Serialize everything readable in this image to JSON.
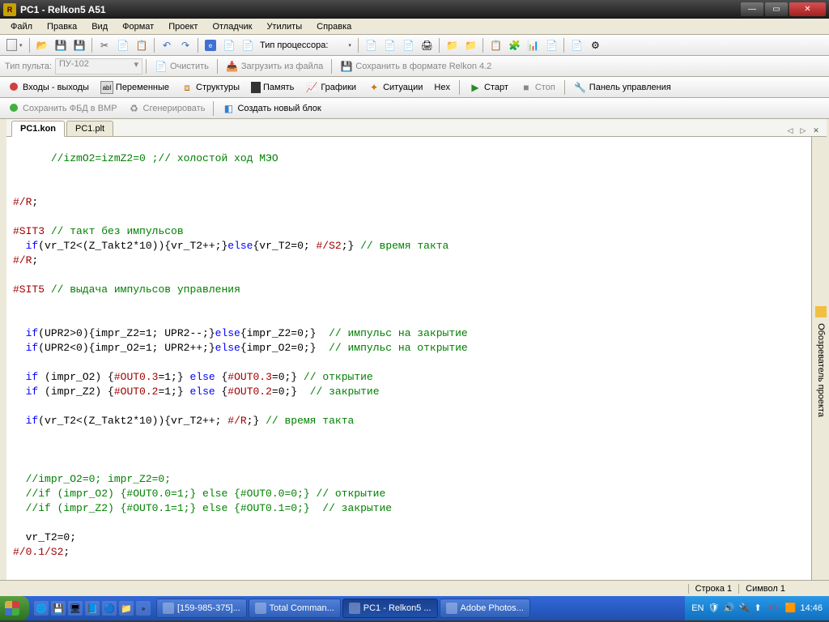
{
  "window": {
    "title": "PC1 - Relkon5 A51"
  },
  "menu": [
    "Файл",
    "Правка",
    "Вид",
    "Формат",
    "Проект",
    "Отладчик",
    "Утилиты",
    "Справка"
  ],
  "toolbar2": {
    "console_type_label": "Тип пульта:",
    "console_value": "ПУ-102",
    "clear": "Очистить",
    "load_file": "Загрузить из файла",
    "save_fmt": "Сохранить в формате Relkon 4.2",
    "cpu_type": "Тип процессора:"
  },
  "toolbar3": {
    "io": "Входы - выходы",
    "vars": "Переменные",
    "structs": "Структуры",
    "mem": "Память",
    "charts": "Графики",
    "sit": "Ситуации",
    "hex": "Hex",
    "start": "Старт",
    "stop": "Стоп",
    "panel": "Панель управления"
  },
  "toolbar4": {
    "save_fbd": "Сохранить ФБД в BMP",
    "regen": "Сгенерировать",
    "newblock": "Создать новый блок"
  },
  "tabs": {
    "t1": "PC1.kon",
    "t2": "PC1.plt"
  },
  "code": [
    {
      "pre": "      ",
      "seg": [
        {
          "c": "com",
          "t": "//izmO2=izmZ2=0 ;// холостой ход МЭО"
        }
      ]
    },
    {
      "pre": "",
      "seg": []
    },
    {
      "pre": "",
      "seg": []
    },
    {
      "pre": "",
      "seg": [
        {
          "c": "dir",
          "t": "#/R"
        },
        {
          "c": "txt",
          "t": ";"
        }
      ]
    },
    {
      "pre": "",
      "seg": []
    },
    {
      "pre": "",
      "seg": [
        {
          "c": "dir",
          "t": "#SIT3"
        },
        {
          "c": "txt",
          "t": " "
        },
        {
          "c": "com",
          "t": "// такт без импульсов"
        }
      ]
    },
    {
      "pre": "  ",
      "seg": [
        {
          "c": "key",
          "t": "if"
        },
        {
          "c": "txt",
          "t": "(vr_T2<(Z_Takt2*10)){vr_T2++;}"
        },
        {
          "c": "key",
          "t": "else"
        },
        {
          "c": "txt",
          "t": "{vr_T2=0; "
        },
        {
          "c": "dir",
          "t": "#/S2"
        },
        {
          "c": "txt",
          "t": ";} "
        },
        {
          "c": "com",
          "t": "// время такта"
        }
      ]
    },
    {
      "pre": "",
      "seg": [
        {
          "c": "dir",
          "t": "#/R"
        },
        {
          "c": "txt",
          "t": ";"
        }
      ]
    },
    {
      "pre": "",
      "seg": []
    },
    {
      "pre": "",
      "seg": [
        {
          "c": "dir",
          "t": "#SIT5"
        },
        {
          "c": "txt",
          "t": " "
        },
        {
          "c": "com",
          "t": "// выдача импульсов управления"
        }
      ]
    },
    {
      "pre": "",
      "seg": []
    },
    {
      "pre": "",
      "seg": []
    },
    {
      "pre": "  ",
      "seg": [
        {
          "c": "key",
          "t": "if"
        },
        {
          "c": "txt",
          "t": "(UPR2>0){impr_Z2=1; UPR2--;}"
        },
        {
          "c": "key",
          "t": "else"
        },
        {
          "c": "txt",
          "t": "{impr_Z2=0;}  "
        },
        {
          "c": "com",
          "t": "// импульс на закрытие"
        }
      ]
    },
    {
      "pre": "  ",
      "seg": [
        {
          "c": "key",
          "t": "if"
        },
        {
          "c": "txt",
          "t": "(UPR2<0){impr_O2=1; UPR2++;}"
        },
        {
          "c": "key",
          "t": "else"
        },
        {
          "c": "txt",
          "t": "{impr_O2=0;}  "
        },
        {
          "c": "com",
          "t": "// импульс на открытие"
        }
      ]
    },
    {
      "pre": "",
      "seg": []
    },
    {
      "pre": "  ",
      "seg": [
        {
          "c": "key",
          "t": "if"
        },
        {
          "c": "txt",
          "t": " (impr_O2) {"
        },
        {
          "c": "dir",
          "t": "#OUT0.3"
        },
        {
          "c": "txt",
          "t": "=1;} "
        },
        {
          "c": "key",
          "t": "else"
        },
        {
          "c": "txt",
          "t": " {"
        },
        {
          "c": "dir",
          "t": "#OUT0.3"
        },
        {
          "c": "txt",
          "t": "=0;} "
        },
        {
          "c": "com",
          "t": "// открытие"
        }
      ]
    },
    {
      "pre": "  ",
      "seg": [
        {
          "c": "key",
          "t": "if"
        },
        {
          "c": "txt",
          "t": " (impr_Z2) {"
        },
        {
          "c": "dir",
          "t": "#OUT0.2"
        },
        {
          "c": "txt",
          "t": "=1;} "
        },
        {
          "c": "key",
          "t": "else"
        },
        {
          "c": "txt",
          "t": " {"
        },
        {
          "c": "dir",
          "t": "#OUT0.2"
        },
        {
          "c": "txt",
          "t": "=0;}  "
        },
        {
          "c": "com",
          "t": "// закрытие"
        }
      ]
    },
    {
      "pre": "",
      "seg": []
    },
    {
      "pre": "  ",
      "seg": [
        {
          "c": "key",
          "t": "if"
        },
        {
          "c": "txt",
          "t": "(vr_T2<(Z_Takt2*10)){vr_T2++; "
        },
        {
          "c": "dir",
          "t": "#/R"
        },
        {
          "c": "txt",
          "t": ";} "
        },
        {
          "c": "com",
          "t": "// время такта"
        }
      ]
    },
    {
      "pre": "",
      "seg": []
    },
    {
      "pre": "",
      "seg": []
    },
    {
      "pre": "",
      "seg": []
    },
    {
      "pre": "  ",
      "seg": [
        {
          "c": "com",
          "t": "//impr_O2=0; impr_Z2=0;"
        }
      ]
    },
    {
      "pre": "  ",
      "seg": [
        {
          "c": "com",
          "t": "//if (impr_O2) {#OUT0.0=1;} else {#OUT0.0=0;} // открытие"
        }
      ]
    },
    {
      "pre": "  ",
      "seg": [
        {
          "c": "com",
          "t": "//if (impr_Z2) {#OUT0.1=1;} else {#OUT0.1=0;}  // закрытие"
        }
      ]
    },
    {
      "pre": "",
      "seg": []
    },
    {
      "pre": "  ",
      "seg": [
        {
          "c": "txt",
          "t": "vr_T2=0;"
        }
      ]
    },
    {
      "pre": "",
      "seg": [
        {
          "c": "dir",
          "t": "#/0.1/S2"
        },
        {
          "c": "txt",
          "t": ";"
        }
      ]
    }
  ],
  "status": {
    "line_label": "Строка 1",
    "col_label": "Символ 1"
  },
  "taskbar": {
    "items": [
      {
        "label": "[159-985-375]..."
      },
      {
        "label": "Total Comman..."
      },
      {
        "label": "PC1 - Relkon5 ...",
        "active": true
      },
      {
        "label": "Adobe Photos..."
      }
    ],
    "lang": "EN",
    "time": "14:46"
  },
  "sidebar_label": "Обозреватель проекта"
}
